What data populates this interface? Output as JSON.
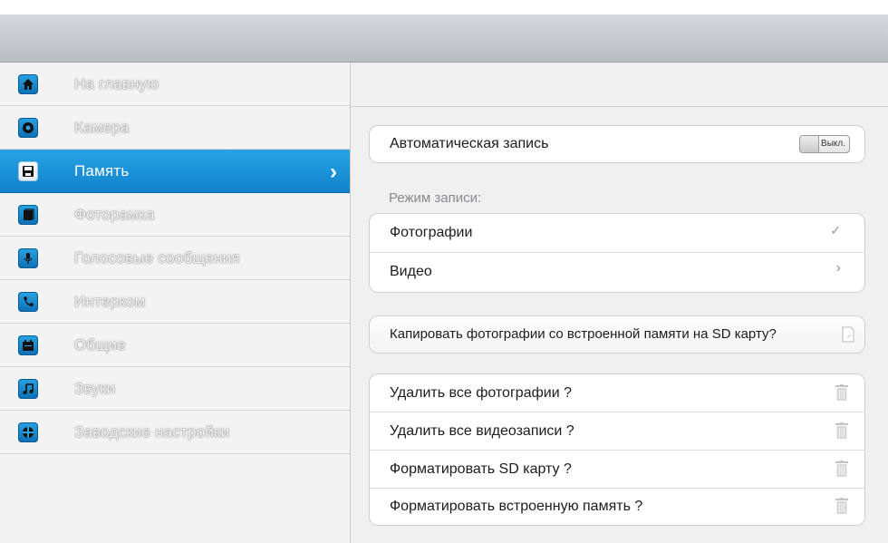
{
  "sidebar": {
    "items": [
      {
        "label": "На главную",
        "icon": "home-icon",
        "active": false
      },
      {
        "label": "Камера",
        "icon": "camera-icon",
        "active": false
      },
      {
        "label": "Память",
        "icon": "floppy-disk-icon",
        "active": true
      },
      {
        "label": "Фоторамка",
        "icon": "photo-frame-icon",
        "active": false
      },
      {
        "label": "Голосовые сообщения",
        "icon": "microphone-icon",
        "active": false
      },
      {
        "label": "Интерком",
        "icon": "phone-icon",
        "active": false
      },
      {
        "label": "Общие",
        "icon": "calendar-icon",
        "active": false
      },
      {
        "label": "Звуки",
        "icon": "music-note-icon",
        "active": false
      },
      {
        "label": "Заводские настройки",
        "icon": "factory-reset-icon",
        "active": false
      }
    ]
  },
  "content": {
    "auto_record": {
      "label": "Автоматическая запись",
      "toggle_text": "Выкл."
    },
    "record_mode": {
      "section_label": "Режим записи:",
      "options": [
        {
          "label": "Фотографии",
          "selected": true
        },
        {
          "label": "Видео",
          "selected": false
        }
      ]
    },
    "copy": {
      "label": "Капировать фотографии со встроенной памяти на SD карту?"
    },
    "actions": [
      {
        "label": "Удалить все фотографии ?"
      },
      {
        "label": "Удалить все видеозаписи ?"
      },
      {
        "label": "Форматировать SD карту ?"
      },
      {
        "label": "Форматировать встроенную память ?"
      }
    ]
  },
  "colors": {
    "accent": "#1890d6",
    "background": "#f0f0f1",
    "row": "#ffffff"
  }
}
